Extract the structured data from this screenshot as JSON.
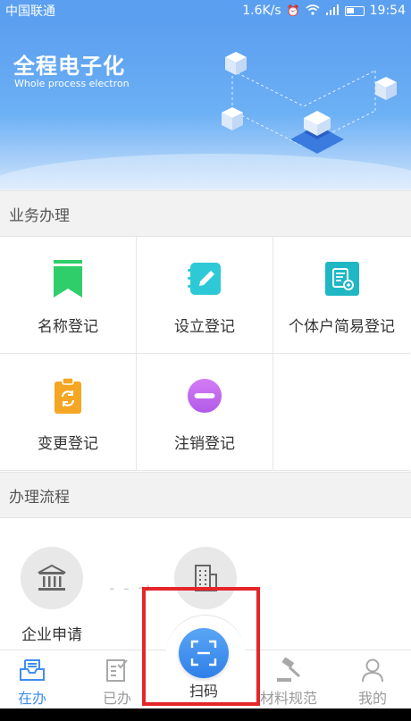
{
  "status_bar": {
    "carrier": "中国联通",
    "network_speed": "1.6K/s",
    "time": "19:54"
  },
  "banner": {
    "title": "全程电子化",
    "subtitle": "Whole process electron"
  },
  "business_section": {
    "header": "业务办理",
    "items": [
      {
        "label": "名称登记",
        "icon": "bookmark-icon",
        "color": "#2fce6a"
      },
      {
        "label": "设立登记",
        "icon": "notebook-pen-icon",
        "color": "#2ec9d6"
      },
      {
        "label": "个体户简易登记",
        "icon": "document-icon",
        "color": "#1fb7c4"
      },
      {
        "label": "变更登记",
        "icon": "clipboard-refresh-icon",
        "color": "#f5a623"
      },
      {
        "label": "注销登记",
        "icon": "minus-circle-icon",
        "color": "#c26bf0"
      }
    ]
  },
  "process_section": {
    "header": "办理流程",
    "steps": [
      {
        "label": "企业申请",
        "icon": "bank-icon"
      }
    ]
  },
  "tabbar": {
    "tabs": [
      {
        "label": "在办",
        "icon": "inbox-icon",
        "active": true
      },
      {
        "label": "已办",
        "icon": "checklist-icon",
        "active": false
      },
      {
        "label": "材料规范",
        "icon": "gavel-icon",
        "active": false
      },
      {
        "label": "我的",
        "icon": "person-icon",
        "active": false
      }
    ],
    "scan_label": "扫码",
    "accent_color": "#3f8ef0"
  }
}
